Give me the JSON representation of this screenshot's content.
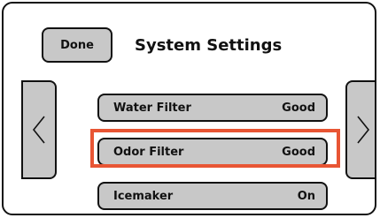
{
  "header": {
    "done_label": "Done",
    "title": "System Settings"
  },
  "navigation": {
    "prev_icon": "chevron-left-icon",
    "next_icon": "chevron-right-icon"
  },
  "settings": [
    {
      "label": "Water Filter",
      "value": "Good"
    },
    {
      "label": "Odor Filter",
      "value": "Good"
    },
    {
      "label": "Icemaker",
      "value": "On"
    }
  ],
  "highlight": {
    "target": "Odor Filter",
    "color": "#e85534"
  },
  "colors": {
    "button_fill": "#c8c8c8",
    "border": "#111111",
    "background": "#ffffff"
  }
}
